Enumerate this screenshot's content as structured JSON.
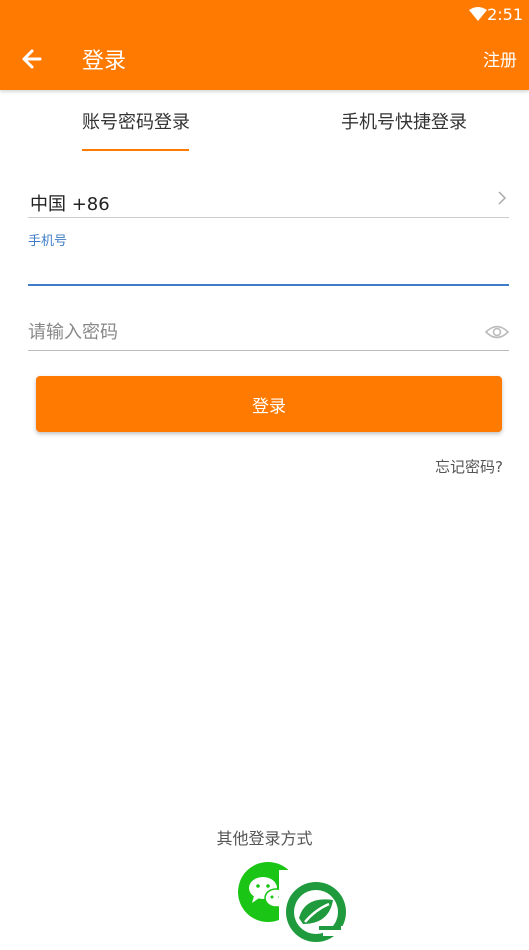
{
  "status_bar": {
    "time": "2:51",
    "wifi_icon": "wifi-icon"
  },
  "app_bar": {
    "title": "登录",
    "register_label": "注册",
    "back_icon": "arrow-left-icon"
  },
  "tabs": [
    {
      "label": "账号密码登录",
      "selected": true
    },
    {
      "label": "手机号快捷登录",
      "selected": false
    }
  ],
  "form": {
    "country": "中国 +86",
    "phone_label": "手机号",
    "phone_value": "",
    "password_placeholder": "请输入密码",
    "login_label": "登录",
    "forgot_label": "忘记密码?"
  },
  "other_login": {
    "label": "其他登录方式",
    "wechat_icon": "wechat-icon"
  },
  "colors": {
    "accent": "#ff7a00",
    "input_focus": "#3f7ec6",
    "wechat": "#1ac516",
    "logo_green": "#1f9a3c"
  }
}
